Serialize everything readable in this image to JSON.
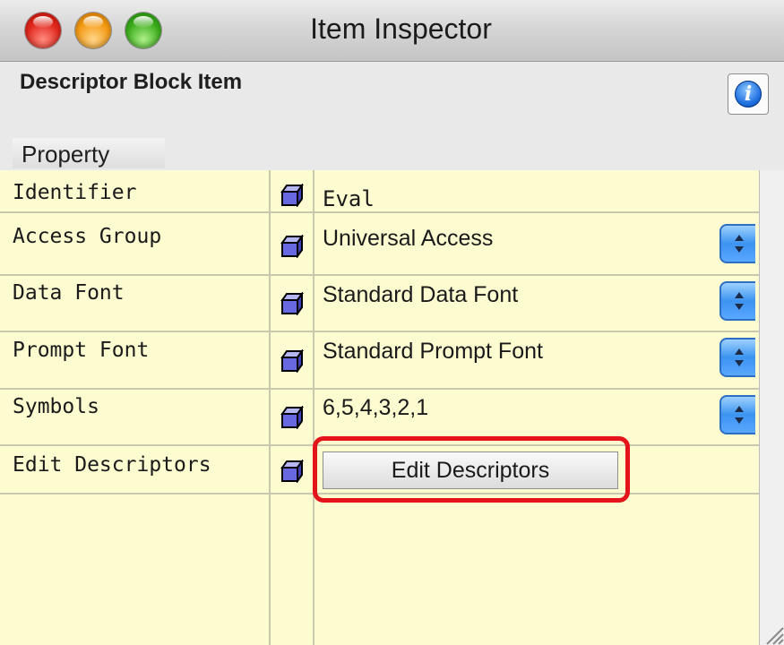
{
  "window": {
    "title": "Item Inspector",
    "traffic_lights": [
      "close",
      "minimize",
      "zoom"
    ]
  },
  "header": {
    "item_name": "Descriptor Block Item",
    "info_icon": "i",
    "column_header": "Property"
  },
  "rows": [
    {
      "label": "Identifier",
      "value": "Eval",
      "has_popup": false
    },
    {
      "label": "Access Group",
      "value": "Universal Access",
      "has_popup": true
    },
    {
      "label": "Data Font",
      "value": "Standard Data Font",
      "has_popup": true
    },
    {
      "label": "Prompt Font",
      "value": "Standard Prompt Font",
      "has_popup": true
    },
    {
      "label": "Symbols",
      "value": "6,5,4,3,2,1",
      "has_popup": true
    },
    {
      "label": "Edit Descriptors",
      "button_label": "Edit Descriptors"
    }
  ],
  "colors": {
    "grid_background": "#fdfbd0",
    "highlight": "#e3141a",
    "popup_accent": "#3c93f0"
  },
  "icons": [
    "cube-icon",
    "info-icon",
    "popup-arrows-icon",
    "resize-grip-icon"
  ]
}
